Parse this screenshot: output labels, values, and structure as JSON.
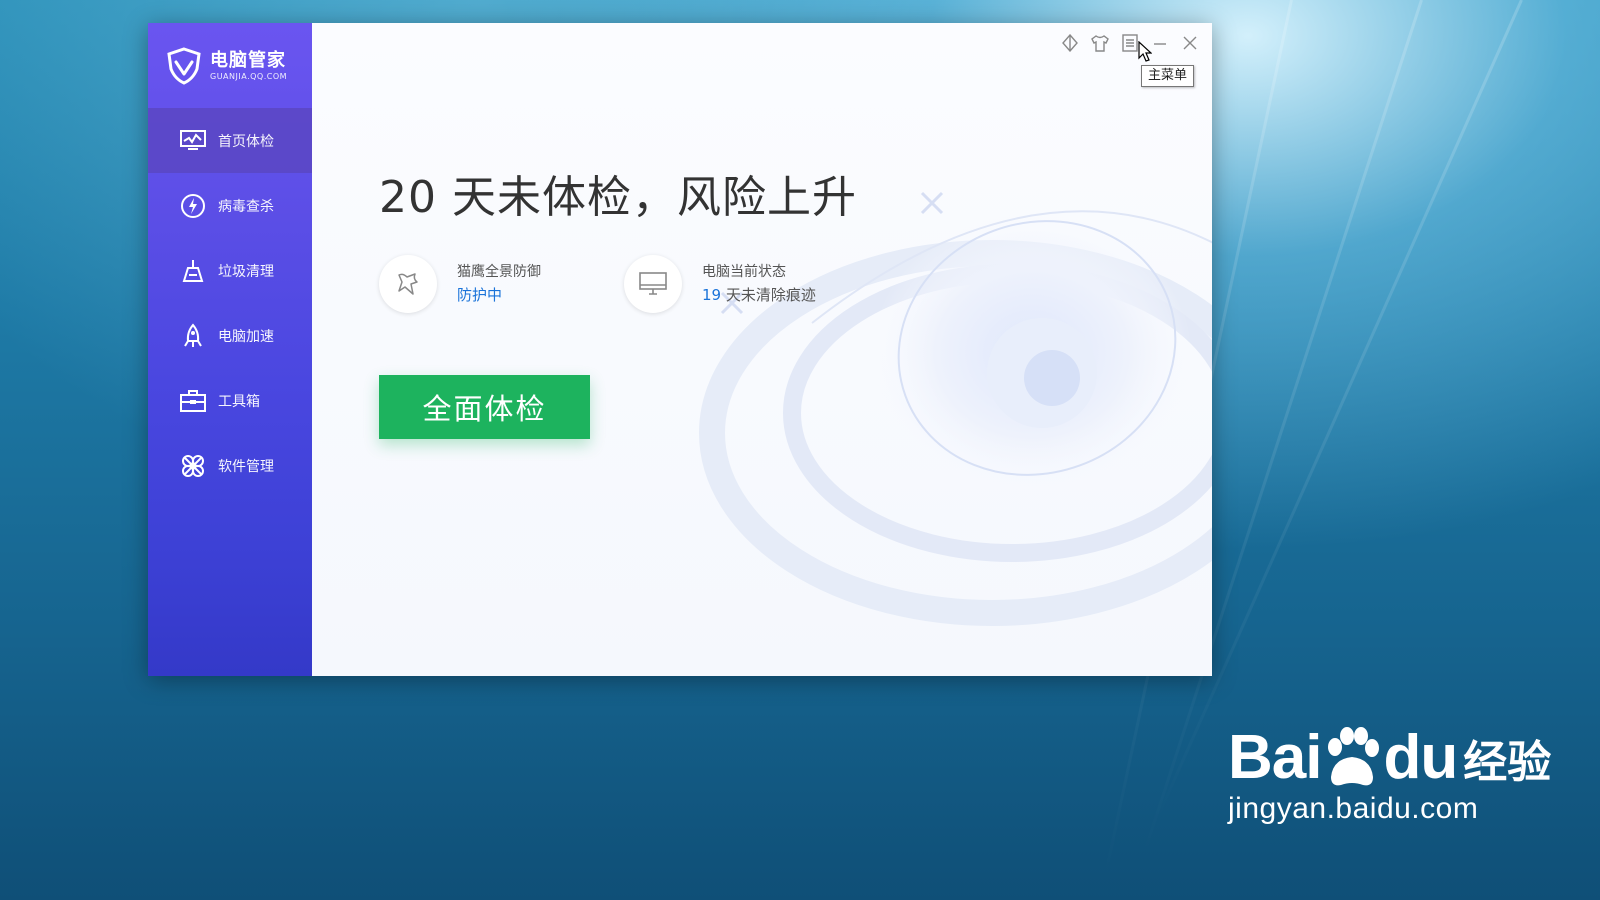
{
  "app": {
    "brand_name": "电脑管家",
    "brand_domain": "GUANJIA.QQ.COM"
  },
  "sidebar": {
    "items": [
      {
        "label": "首页体检",
        "icon": "monitor-checkup-icon",
        "active": true
      },
      {
        "label": "病毒查杀",
        "icon": "lightning-shield-icon",
        "active": false
      },
      {
        "label": "垃圾清理",
        "icon": "broom-icon",
        "active": false
      },
      {
        "label": "电脑加速",
        "icon": "rocket-icon",
        "active": false
      },
      {
        "label": "工具箱",
        "icon": "toolbox-icon",
        "active": false
      },
      {
        "label": "软件管理",
        "icon": "clover-icon",
        "active": false
      }
    ]
  },
  "title_controls": {
    "tooltip": "主菜单",
    "icons": [
      "skin-icon",
      "shirt-icon",
      "menu-icon",
      "minimize-icon",
      "close-icon"
    ]
  },
  "main": {
    "headline": "20 天未体检，风险上升",
    "defense": {
      "title": "猫鹰全景防御",
      "status": "防护中"
    },
    "pc_status": {
      "title": "电脑当前状态",
      "days": "19",
      "suffix": " 天未清除痕迹"
    },
    "scan_button": "全面体检"
  },
  "watermark": {
    "left": "Bai",
    "right": "du",
    "cn": "经验",
    "url": "jingyan.baidu.com"
  },
  "colors": {
    "sidebar_top": "#6a55f0",
    "sidebar_bottom": "#3439c8",
    "accent_green": "#1db35e",
    "link_blue": "#1a73d9"
  }
}
